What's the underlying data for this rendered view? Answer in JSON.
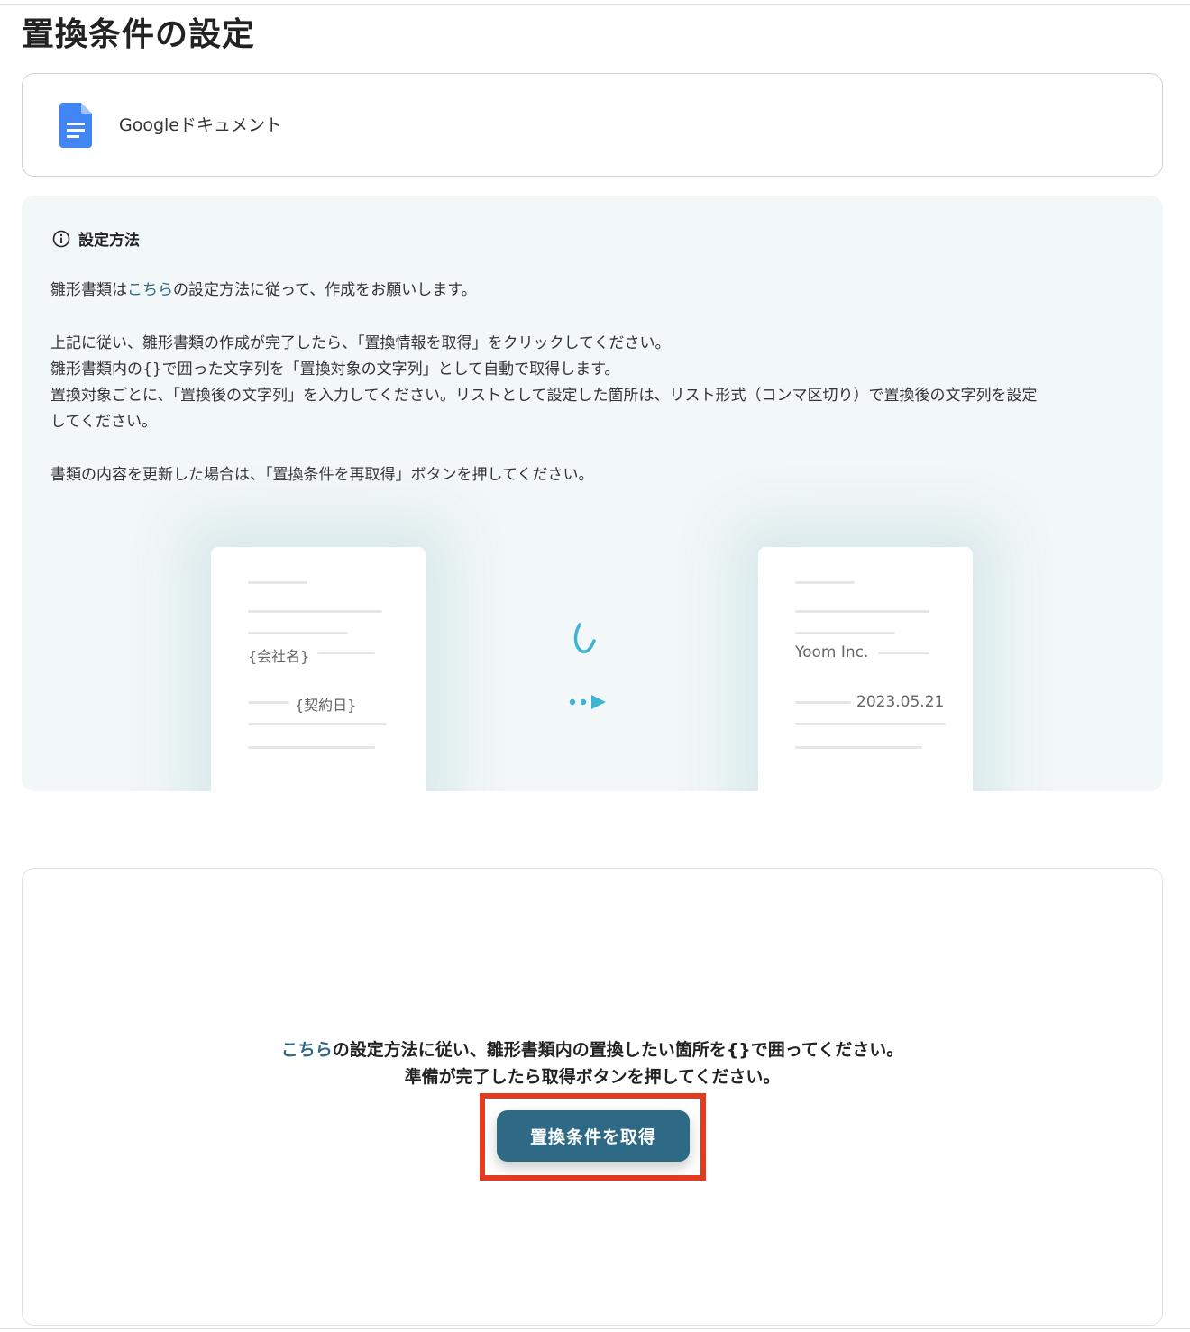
{
  "page": {
    "title": "置換条件の設定"
  },
  "app": {
    "name": "Googleドキュメント",
    "icon": "google-docs-icon",
    "icon_color": "#4285f4"
  },
  "info": {
    "title": "設定方法",
    "icon": "info-icon",
    "line1_a": "雛形書類は",
    "line1_link": "こちら",
    "line1_b": "の設定方法に従って、作成をお願いします。",
    "line2": "上記に従い、雛形書類の作成が完了したら、「置換情報を取得」をクリックしてください。",
    "line3": "雛形書類内の{}で囲った文字列を「置換対象の文字列」として自動で取得します。",
    "line4": "置換対象ごとに、「置換後の文字列」を入力してください。リストとして設定した箇所は、リスト形式（コンマ区切り）で置換後の文字列を設定",
    "line5": "してください。",
    "line6": "書類の内容を更新した場合は、「置換条件を再取得」ボタンを押してください。"
  },
  "illustration": {
    "template_company": "{会社名}",
    "template_date": "{契約日}",
    "result_company": "Yoom Inc.",
    "result_date": "2023.05.21",
    "accent_color": "#3fb3d3"
  },
  "fetch": {
    "link": "こちら",
    "line1_rest": "の設定方法に従い、雛形書類内の置換したい箇所を{}で囲ってください。",
    "line2": "準備が完了したら取得ボタンを押してください。",
    "button_label": "置換条件を取得",
    "button_color": "#2e6a86",
    "highlight_color": "#e23b20"
  }
}
